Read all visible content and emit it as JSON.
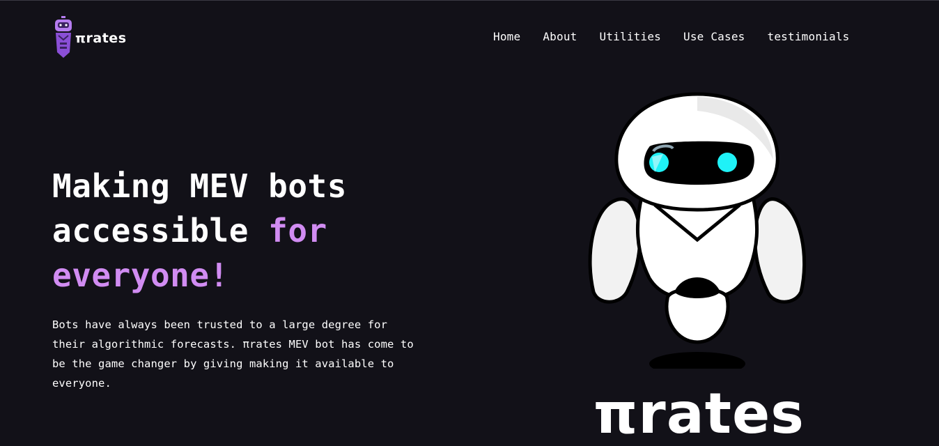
{
  "header": {
    "brand": "πrates",
    "nav": [
      {
        "label": "Home"
      },
      {
        "label": "About"
      },
      {
        "label": "Utilities"
      },
      {
        "label": "Use Cases"
      },
      {
        "label": "testimonials"
      }
    ]
  },
  "hero": {
    "title_line1": "Making MEV bots",
    "title_line2a": "accessible ",
    "title_line2b": "for",
    "title_line3": "everyone!",
    "description": "Bots have always been trusted to a large degree for their algorithmic forecasts. πrates MEV bot has come to be the game changer by giving making it available to everyone.",
    "brand_big": "πrates"
  },
  "colors": {
    "background": "#121118",
    "accent": "#d18cf2",
    "robot_eye": "#1ff2f7",
    "logo_purple": "#9b5de5"
  },
  "icons": {
    "logo": "robot-logo-icon",
    "illustration": "robot-mascot-illustration"
  }
}
